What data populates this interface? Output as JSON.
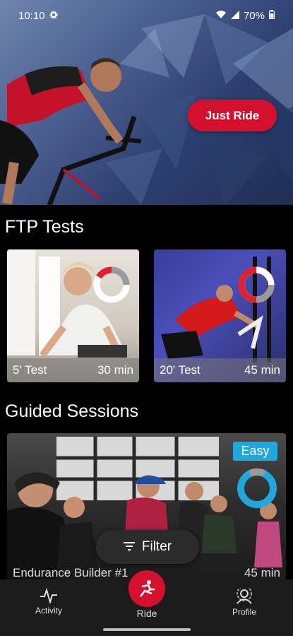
{
  "status_bar": {
    "time": "10:10",
    "battery": "70%"
  },
  "hero": {
    "button_label": "Just Ride"
  },
  "ftp": {
    "title": "FTP Tests",
    "cards": [
      {
        "name": "5' Test",
        "duration": "30 min"
      },
      {
        "name": "20' Test",
        "duration": "45 min"
      }
    ]
  },
  "guided": {
    "title": "Guided Sessions",
    "card": {
      "badge": "Easy",
      "name": "Endurance Builder #1",
      "duration": "45 min"
    }
  },
  "filter": {
    "label": "Filter"
  },
  "nav": {
    "activity": "Activity",
    "ride": "Ride",
    "profile": "Profile"
  },
  "colors": {
    "accent": "#d5102c",
    "easy": "#20a8dc",
    "nav_bg": "#1c1c1c"
  }
}
